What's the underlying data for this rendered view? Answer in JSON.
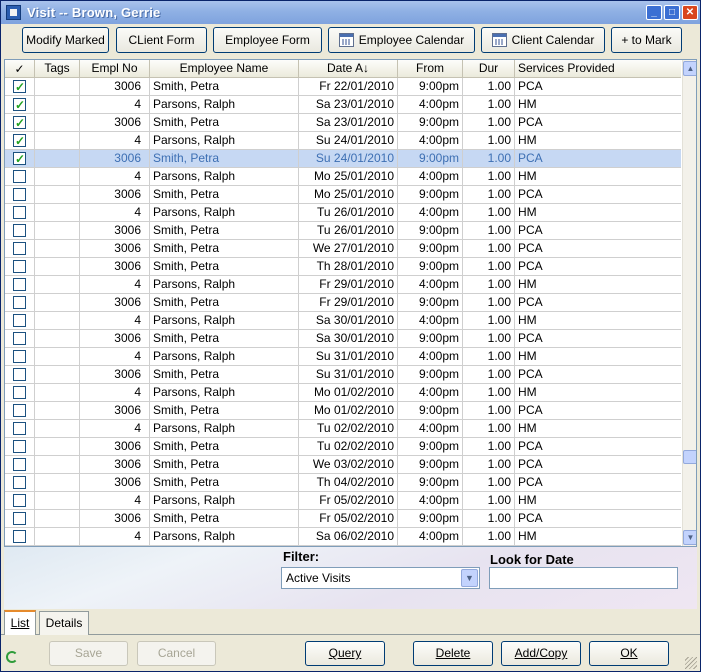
{
  "window": {
    "title": "Visit  -- Brown, Gerrie"
  },
  "toolbar": {
    "buttons": [
      {
        "label": "Modify Marked"
      },
      {
        "label": "CLient Form"
      },
      {
        "label": "Employee Form"
      },
      {
        "label": "Employee Calendar",
        "icon": "calendar-icon"
      },
      {
        "label": "Client Calendar",
        "icon": "calendar-icon"
      },
      {
        "label": "+ to Mark"
      }
    ]
  },
  "grid": {
    "columns": [
      "✓",
      "Tags",
      "Empl No",
      "Employee Name",
      "Date A↓",
      "From",
      "Dur",
      "Services Provided"
    ],
    "rows": [
      {
        "checked": true,
        "tags": "",
        "empl": "3006",
        "name": "Smith, Petra",
        "date": "Fr 22/01/2010",
        "from": "9:00pm",
        "dur": "1.00",
        "svc": "PCA"
      },
      {
        "checked": true,
        "tags": "",
        "empl": "4",
        "name": "Parsons, Ralph",
        "date": "Sa 23/01/2010",
        "from": "4:00pm",
        "dur": "1.00",
        "svc": "HM"
      },
      {
        "checked": true,
        "tags": "",
        "empl": "3006",
        "name": "Smith, Petra",
        "date": "Sa 23/01/2010",
        "from": "9:00pm",
        "dur": "1.00",
        "svc": "PCA"
      },
      {
        "checked": true,
        "tags": "",
        "empl": "4",
        "name": "Parsons, Ralph",
        "date": "Su 24/01/2010",
        "from": "4:00pm",
        "dur": "1.00",
        "svc": "HM"
      },
      {
        "checked": true,
        "tags": "",
        "empl": "3006",
        "name": "Smith, Petra",
        "date": "Su 24/01/2010",
        "from": "9:00pm",
        "dur": "1.00",
        "svc": "PCA",
        "selected": true
      },
      {
        "checked": false,
        "tags": "",
        "empl": "4",
        "name": "Parsons, Ralph",
        "date": "Mo 25/01/2010",
        "from": "4:00pm",
        "dur": "1.00",
        "svc": "HM"
      },
      {
        "checked": false,
        "tags": "",
        "empl": "3006",
        "name": "Smith, Petra",
        "date": "Mo 25/01/2010",
        "from": "9:00pm",
        "dur": "1.00",
        "svc": "PCA"
      },
      {
        "checked": false,
        "tags": "",
        "empl": "4",
        "name": "Parsons, Ralph",
        "date": "Tu 26/01/2010",
        "from": "4:00pm",
        "dur": "1.00",
        "svc": "HM"
      },
      {
        "checked": false,
        "tags": "",
        "empl": "3006",
        "name": "Smith, Petra",
        "date": "Tu 26/01/2010",
        "from": "9:00pm",
        "dur": "1.00",
        "svc": "PCA"
      },
      {
        "checked": false,
        "tags": "",
        "empl": "3006",
        "name": "Smith, Petra",
        "date": "We 27/01/2010",
        "from": "9:00pm",
        "dur": "1.00",
        "svc": "PCA"
      },
      {
        "checked": false,
        "tags": "",
        "empl": "3006",
        "name": "Smith, Petra",
        "date": "Th 28/01/2010",
        "from": "9:00pm",
        "dur": "1.00",
        "svc": "PCA"
      },
      {
        "checked": false,
        "tags": "",
        "empl": "4",
        "name": "Parsons, Ralph",
        "date": "Fr 29/01/2010",
        "from": "4:00pm",
        "dur": "1.00",
        "svc": "HM"
      },
      {
        "checked": false,
        "tags": "",
        "empl": "3006",
        "name": "Smith, Petra",
        "date": "Fr 29/01/2010",
        "from": "9:00pm",
        "dur": "1.00",
        "svc": "PCA"
      },
      {
        "checked": false,
        "tags": "",
        "empl": "4",
        "name": "Parsons, Ralph",
        "date": "Sa 30/01/2010",
        "from": "4:00pm",
        "dur": "1.00",
        "svc": "HM"
      },
      {
        "checked": false,
        "tags": "",
        "empl": "3006",
        "name": "Smith, Petra",
        "date": "Sa 30/01/2010",
        "from": "9:00pm",
        "dur": "1.00",
        "svc": "PCA"
      },
      {
        "checked": false,
        "tags": "",
        "empl": "4",
        "name": "Parsons, Ralph",
        "date": "Su 31/01/2010",
        "from": "4:00pm",
        "dur": "1.00",
        "svc": "HM"
      },
      {
        "checked": false,
        "tags": "",
        "empl": "3006",
        "name": "Smith, Petra",
        "date": "Su 31/01/2010",
        "from": "9:00pm",
        "dur": "1.00",
        "svc": "PCA"
      },
      {
        "checked": false,
        "tags": "",
        "empl": "4",
        "name": "Parsons, Ralph",
        "date": "Mo 01/02/2010",
        "from": "4:00pm",
        "dur": "1.00",
        "svc": "HM"
      },
      {
        "checked": false,
        "tags": "",
        "empl": "3006",
        "name": "Smith, Petra",
        "date": "Mo 01/02/2010",
        "from": "9:00pm",
        "dur": "1.00",
        "svc": "PCA"
      },
      {
        "checked": false,
        "tags": "",
        "empl": "4",
        "name": "Parsons, Ralph",
        "date": "Tu 02/02/2010",
        "from": "4:00pm",
        "dur": "1.00",
        "svc": "HM"
      },
      {
        "checked": false,
        "tags": "",
        "empl": "3006",
        "name": "Smith, Petra",
        "date": "Tu 02/02/2010",
        "from": "9:00pm",
        "dur": "1.00",
        "svc": "PCA"
      },
      {
        "checked": false,
        "tags": "",
        "empl": "3006",
        "name": "Smith, Petra",
        "date": "We 03/02/2010",
        "from": "9:00pm",
        "dur": "1.00",
        "svc": "PCA"
      },
      {
        "checked": false,
        "tags": "",
        "empl": "3006",
        "name": "Smith, Petra",
        "date": "Th 04/02/2010",
        "from": "9:00pm",
        "dur": "1.00",
        "svc": "PCA"
      },
      {
        "checked": false,
        "tags": "",
        "empl": "4",
        "name": "Parsons, Ralph",
        "date": "Fr 05/02/2010",
        "from": "4:00pm",
        "dur": "1.00",
        "svc": "HM"
      },
      {
        "checked": false,
        "tags": "",
        "empl": "3006",
        "name": "Smith, Petra",
        "date": "Fr 05/02/2010",
        "from": "9:00pm",
        "dur": "1.00",
        "svc": "PCA"
      },
      {
        "checked": false,
        "tags": "",
        "empl": "4",
        "name": "Parsons, Ralph",
        "date": "Sa 06/02/2010",
        "from": "4:00pm",
        "dur": "1.00",
        "svc": "HM"
      }
    ]
  },
  "filter": {
    "label": "Filter:",
    "selected": "Active Visits"
  },
  "lookfor": {
    "label": "Look for Date",
    "value": ""
  },
  "tabs": [
    {
      "label": "List",
      "active": true
    },
    {
      "label": "Details",
      "active": false
    }
  ],
  "footer": {
    "save_label": "Save",
    "cancel_label": "Cancel",
    "query_label": "Query",
    "delete_label": "Delete",
    "addcopy_label": "Add/Copy",
    "ok_label": "OK"
  }
}
